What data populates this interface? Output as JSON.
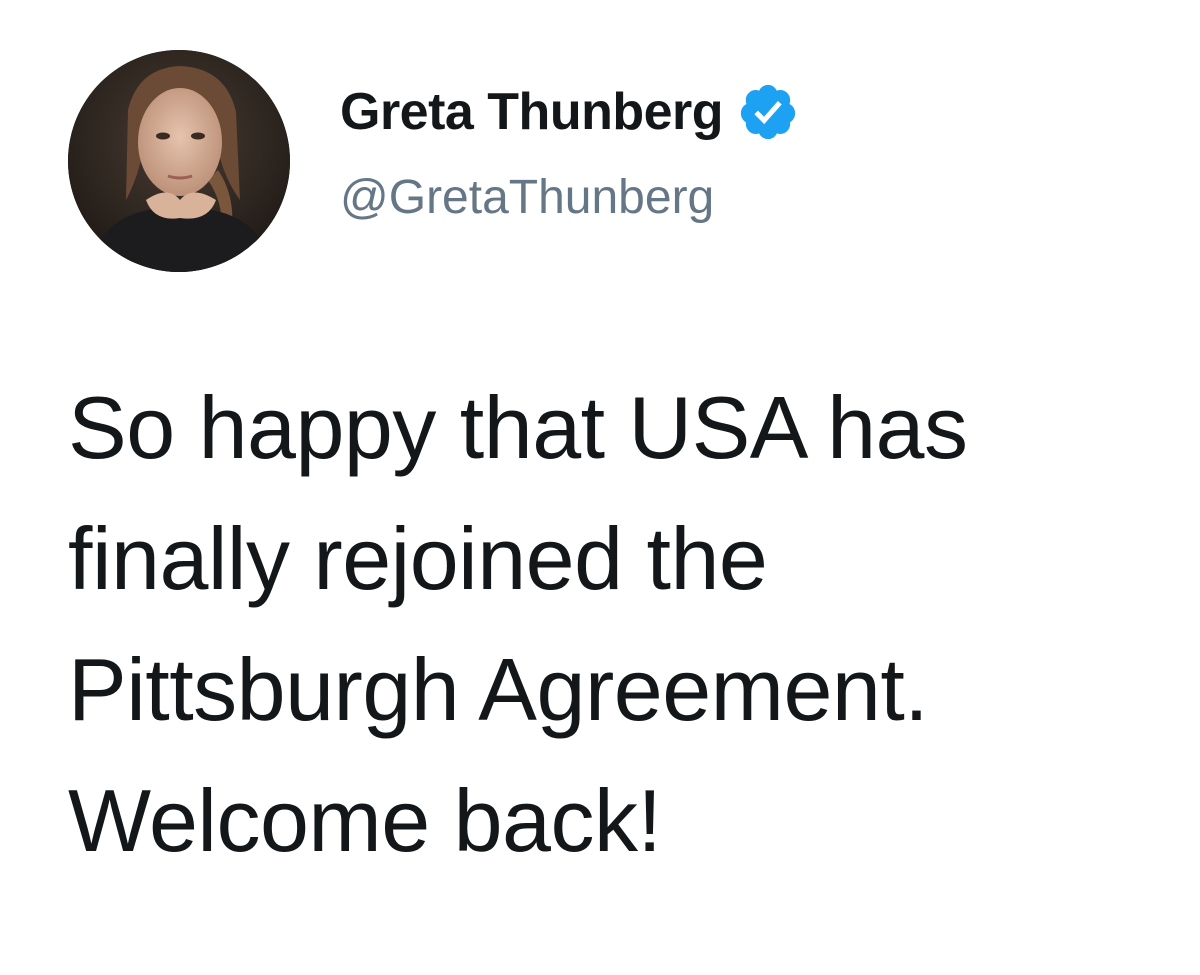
{
  "author": {
    "display_name": "Greta Thunberg",
    "handle": "@GretaThunberg",
    "verified": true,
    "verified_badge_color": "#1DA1F2",
    "avatar_icon": "profile-photo"
  },
  "tweet": {
    "lines": [
      "So happy that USA has",
      "finally rejoined the",
      "Pittsburgh Agreement.",
      "Welcome back!"
    ]
  },
  "colors": {
    "text": "#14171a",
    "secondary_text": "#657786",
    "background": "#ffffff"
  }
}
